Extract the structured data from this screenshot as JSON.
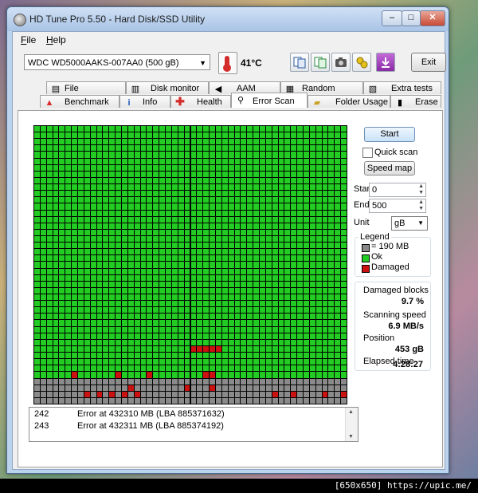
{
  "window": {
    "title": "HD Tune Pro 5.50 - Hard Disk/SSD Utility"
  },
  "window_controls": {
    "minimize": "–",
    "maximize": "□",
    "close": "✕"
  },
  "menu": {
    "file": "ile",
    "file_key": "F",
    "help": "elp",
    "help_key": "H"
  },
  "toolbar": {
    "drive": "WDC WD5000AAKS-007AA0 (500 gB)",
    "temperature": "41°C",
    "exit_label": "Exit"
  },
  "tabs_top": [
    "File Benchmark",
    "Disk monitor",
    "AAM",
    "Random Access",
    "Extra tests"
  ],
  "tabs_bottom": [
    "Benchmark",
    "Info",
    "Health",
    "Error Scan",
    "Folder Usage",
    "Erase"
  ],
  "active_tab": "Error Scan",
  "controls": {
    "start_label": "Start",
    "quick_scan_label": "Quick scan",
    "quick_scan_checked": false,
    "speed_map_label": "Speed map",
    "start_field_label": "Start",
    "start_value": "0",
    "end_field_label": "End",
    "end_value": "500",
    "unit_label": "Unit",
    "unit_value": "gB"
  },
  "legend": {
    "title": "Legend",
    "block_size": "= 190 MB",
    "ok": "Ok",
    "damaged": "Damaged"
  },
  "colors": {
    "ok": "#22cc22",
    "damaged": "#cc1111",
    "unscanned": "#8a8a8a"
  },
  "stats": {
    "damaged_blocks_label": "Damaged blocks",
    "damaged_blocks_value": "9.7 %",
    "scanning_speed_label": "Scanning speed",
    "scanning_speed_value": "6.9 MB/s",
    "position_label": "Position",
    "position_value": "453 gB",
    "elapsed_label": "Elapsed time",
    "elapsed_value": "4:28:27"
  },
  "scan_map": {
    "columns": 50,
    "rows": 43,
    "green_rows": 39,
    "damaged_cells": [
      [
        25,
        34
      ],
      [
        26,
        34
      ],
      [
        27,
        34
      ],
      [
        28,
        34
      ],
      [
        29,
        34
      ],
      [
        6,
        38
      ],
      [
        13,
        38
      ],
      [
        18,
        38
      ],
      [
        27,
        38
      ],
      [
        28,
        38
      ],
      [
        15,
        40
      ],
      [
        24,
        40
      ],
      [
        28,
        40
      ],
      [
        8,
        41
      ],
      [
        10,
        41
      ],
      [
        12,
        41
      ],
      [
        14,
        41
      ],
      [
        16,
        41
      ],
      [
        38,
        41
      ],
      [
        41,
        41
      ],
      [
        46,
        41
      ],
      [
        49,
        41
      ]
    ]
  },
  "error_log": [
    {
      "id": "242",
      "message": "Error at 432310 MB (LBA 885371632)"
    },
    {
      "id": "243",
      "message": "Error at 432311 MB (LBA 885374192)"
    }
  ],
  "watermark": "[650x650] https://upic.me/"
}
